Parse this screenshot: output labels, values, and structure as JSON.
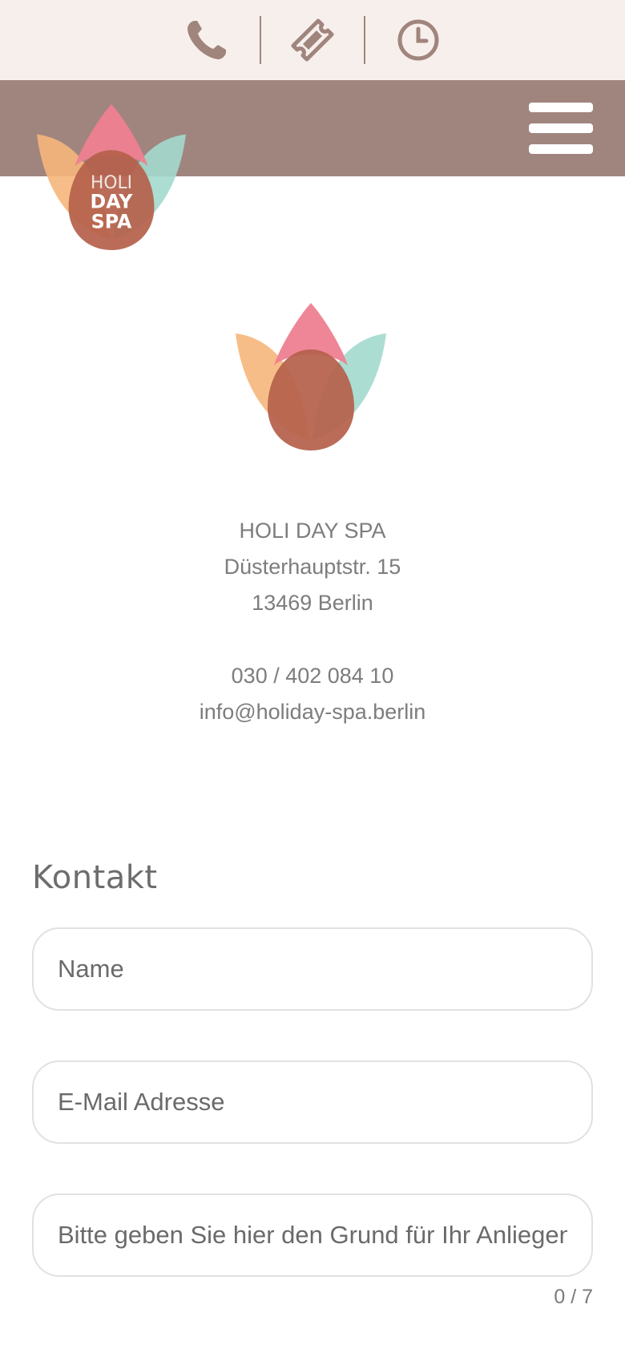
{
  "topbar": {
    "icons": [
      "phone-icon",
      "ticket-icon",
      "clock-icon"
    ]
  },
  "header": {
    "logo_text": [
      "HOLI",
      "DAY",
      "SPA"
    ],
    "menu_icon": "hamburger-menu-icon"
  },
  "address": {
    "name": "HOLI DAY SPA",
    "street": "Düsterhauptstr. 15",
    "city": "13469 Berlin",
    "phone": "030 / 402 084 10",
    "email": "info@holiday-spa.berlin"
  },
  "contact": {
    "title": "Kontakt",
    "name_placeholder": "Name",
    "email_placeholder": "E-Mail Adresse",
    "reason_placeholder": "Bitte geben Sie hier den Grund für Ihr Anliegen an",
    "counter": "0 / 7"
  },
  "colors": {
    "topbar_bg": "#f7efec",
    "header_bg": "#a0857f",
    "icon": "#a0857d",
    "petal_orange": "#f6b67b",
    "petal_teal": "#a3d9cd",
    "petal_pink": "#ee7f91",
    "drop": "#b5614b"
  }
}
